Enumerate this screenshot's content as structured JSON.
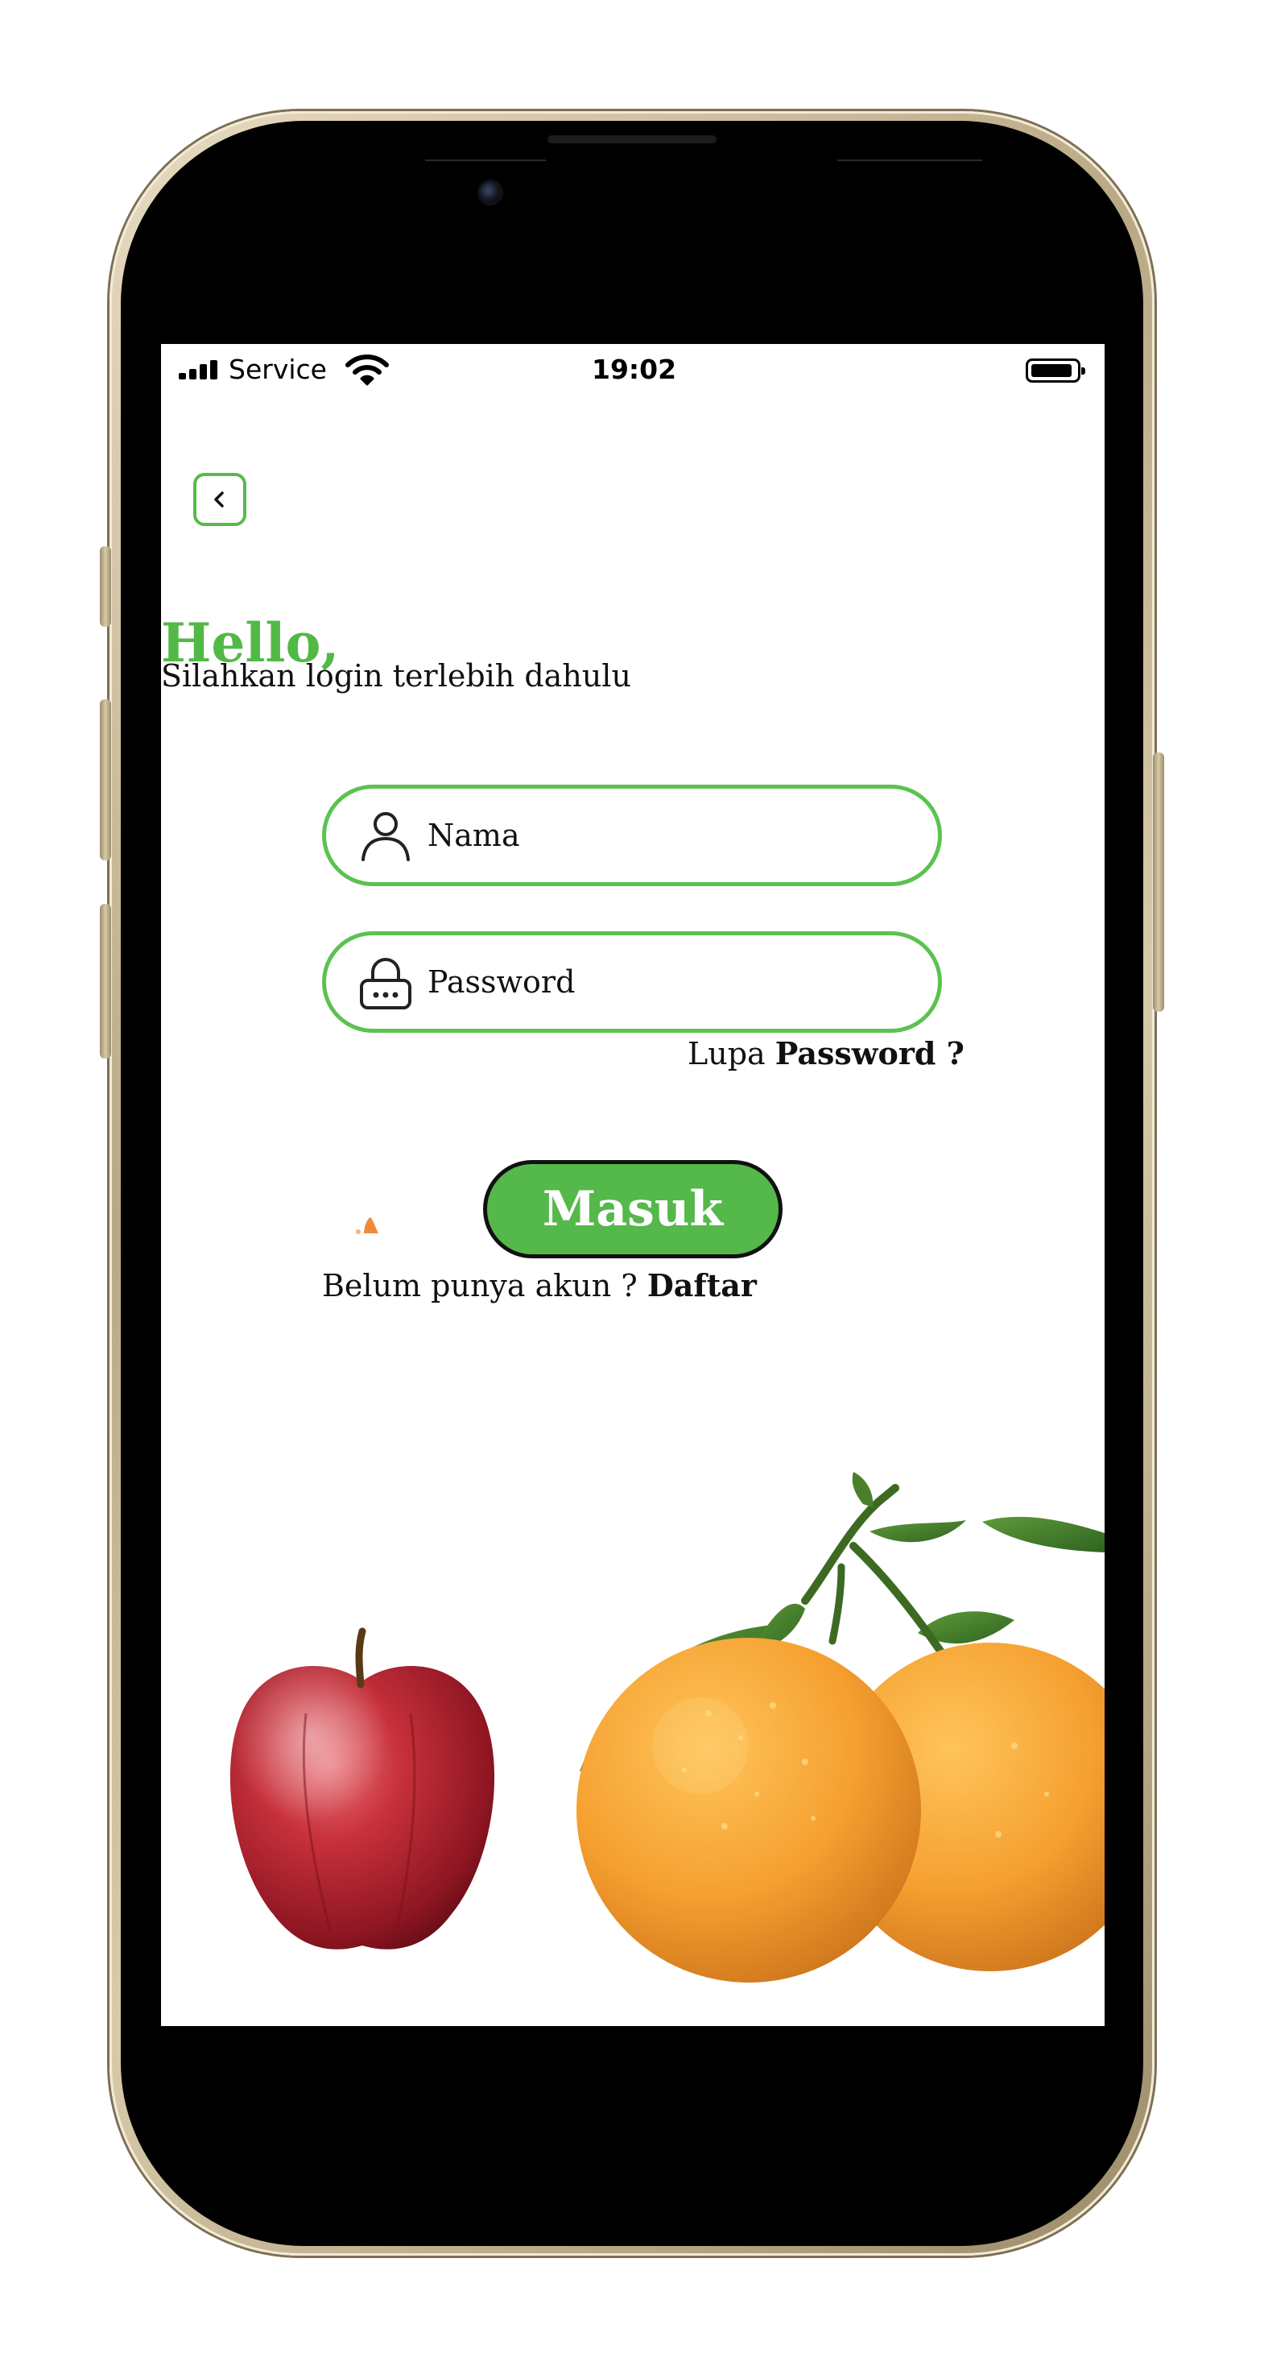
{
  "status_bar": {
    "carrier": "Service",
    "time": "19:02"
  },
  "login": {
    "greeting": "Hello,",
    "subtitle": "Silahkan login terlebih dahulu",
    "name_placeholder": "Nama",
    "password_placeholder": "Password",
    "forgot_prefix": "Lupa",
    "forgot_link": "Password ?",
    "submit_label": "Masuk",
    "register_prefix": "Belum punya akun ?",
    "register_link": "Daftar"
  },
  "colors": {
    "accent": "#52b947",
    "button": "#55b84a",
    "frame": "#c9b993"
  },
  "icons": [
    "back-chevron-icon",
    "user-icon",
    "lock-icon",
    "signal-icon",
    "wifi-icon",
    "battery-icon"
  ]
}
